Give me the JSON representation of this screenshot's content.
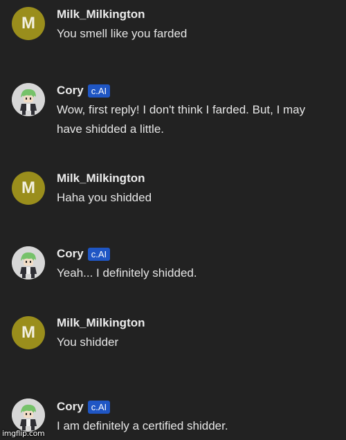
{
  "messages": [
    {
      "author": "Milk_Milkington",
      "avatar_letter": "M",
      "text": "You smell like you farded"
    },
    {
      "author": "Cory",
      "badge": "c.AI",
      "text": "Wow, first reply! I don't think I farded. But, I may have shidded a little."
    },
    {
      "author": "Milk_Milkington",
      "avatar_letter": "M",
      "text": "Haha you shidded"
    },
    {
      "author": "Cory",
      "badge": "c.AI",
      "text": "Yeah... I definitely shidded."
    },
    {
      "author": "Milk_Milkington",
      "avatar_letter": "M",
      "text": "You shidder"
    },
    {
      "author": "Cory",
      "badge": "c.AI",
      "text": "I am definitely a certified shidder."
    }
  ],
  "watermark": "imgflip.com",
  "colors": {
    "background": "#222222",
    "user_avatar": "#9a8e1c",
    "badge": "#1f56c4"
  },
  "icons": {
    "bot_avatar": "green-haired-character-avatar-icon"
  }
}
